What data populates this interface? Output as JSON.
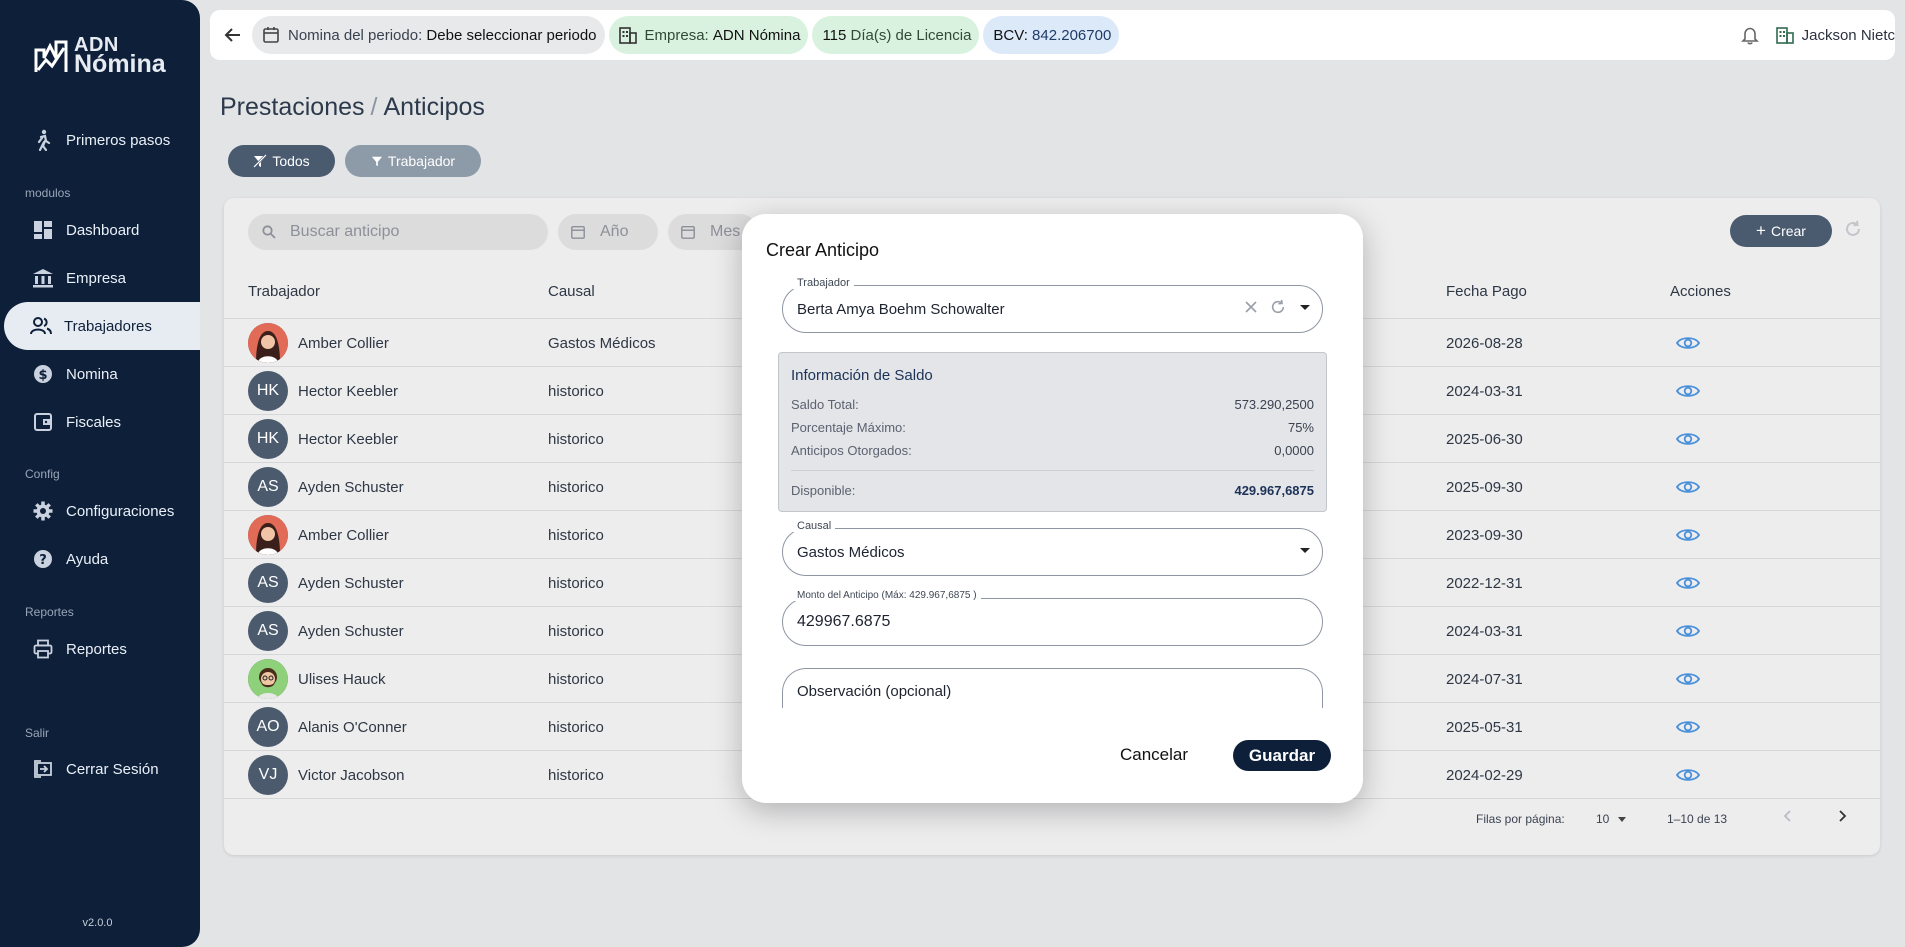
{
  "app": {
    "logo_line1": "ADN",
    "logo_line2": "Nómina",
    "version": "v2.0.0"
  },
  "sidebar": {
    "first_steps": "Primeros pasos",
    "sections": {
      "modulos": "modulos",
      "config": "Config",
      "reportes": "Reportes",
      "salir": "Salir"
    },
    "items": [
      {
        "label": "Dashboard",
        "icon": "dashboard-icon"
      },
      {
        "label": "Empresa",
        "icon": "bank-icon"
      },
      {
        "label": "Trabajadores",
        "icon": "people-icon",
        "active": true
      },
      {
        "label": "Nomina",
        "icon": "dollar-icon"
      },
      {
        "label": "Fiscales",
        "icon": "wallet-icon"
      },
      {
        "label": "Configuraciones",
        "icon": "gear-icon"
      },
      {
        "label": "Ayuda",
        "icon": "help-icon"
      },
      {
        "label": "Reportes",
        "icon": "printer-icon"
      },
      {
        "label": "Cerrar Sesión",
        "icon": "logout-icon"
      }
    ]
  },
  "topbar": {
    "period_label": "Nomina del periodo:",
    "period_value": "Debe seleccionar periodo",
    "company_label": "Empresa:",
    "company_value": "ADN Nómina",
    "license_count": "115",
    "license_label": "Día(s) de Licencia",
    "bcv_label": "BCV:",
    "bcv_value": "842.206700",
    "user_name": "Jackson Nietc"
  },
  "page": {
    "crumb_parent": "Prestaciones",
    "crumb_sep": "/",
    "crumb_current": "Anticipos",
    "filter_all": "Todos",
    "filter_worker": "Trabajador"
  },
  "toolbar": {
    "search_placeholder": "Buscar anticipo",
    "year_placeholder": "Año",
    "month_placeholder": "Mes",
    "create_label": "Crear"
  },
  "table": {
    "headers": {
      "worker": "Trabajador",
      "cause": "Causal",
      "pay_date": "Fecha Pago",
      "actions": "Acciones"
    },
    "rows": [
      {
        "initials": "",
        "photo": "woman",
        "name": "Amber Collier",
        "cause": "Gastos Médicos",
        "date": "2026-08-28"
      },
      {
        "initials": "HK",
        "name": "Hector Keebler",
        "cause": "historico",
        "date": "2024-03-31"
      },
      {
        "initials": "HK",
        "name": "Hector Keebler",
        "cause": "historico",
        "date": "2025-06-30"
      },
      {
        "initials": "AS",
        "name": "Ayden Schuster",
        "cause": "historico",
        "date": "2025-09-30"
      },
      {
        "initials": "",
        "photo": "woman",
        "name": "Amber Collier",
        "cause": "historico",
        "date": "2023-09-30"
      },
      {
        "initials": "AS",
        "name": "Ayden Schuster",
        "cause": "historico",
        "date": "2022-12-31"
      },
      {
        "initials": "AS",
        "name": "Ayden Schuster",
        "cause": "historico",
        "date": "2024-03-31"
      },
      {
        "initials": "",
        "photo": "man",
        "name": "Ulises Hauck",
        "cause": "historico",
        "date": "2024-07-31"
      },
      {
        "initials": "AO",
        "name": "Alanis O'Conner",
        "cause": "historico",
        "date": "2025-05-31"
      },
      {
        "initials": "VJ",
        "name": "Victor Jacobson",
        "cause": "historico",
        "date": "2024-02-29"
      }
    ],
    "rows_per_page_label": "Filas por página:",
    "rows_per_page_value": "10",
    "range_text": "1–10 de 13"
  },
  "dialog": {
    "title": "Crear Anticipo",
    "worker_label": "Trabajador",
    "worker_value": "Berta Amya Boehm Schowalter",
    "info_title": "Información de Saldo",
    "saldo_total_label": "Saldo Total:",
    "saldo_total_value": "573.290,2500",
    "porcentaje_label": "Porcentaje Máximo:",
    "porcentaje_value": "75%",
    "otorgados_label": "Anticipos Otorgados:",
    "otorgados_value": "0,0000",
    "disponible_label": "Disponible:",
    "disponible_value": "429.967,6875",
    "cause_label": "Causal",
    "cause_value": "Gastos Médicos",
    "amount_label": "Monto del Anticipo (Máx: 429.967,6875 )",
    "amount_value": "429967.6875",
    "observation_placeholder": "Observación (opcional)",
    "cancel_label": "Cancelar",
    "save_label": "Guardar"
  },
  "colors": {
    "sidebar_bg": "#0e1f3a",
    "accent_blue": "#4a90d9",
    "button_dark": "#4a5b70"
  }
}
